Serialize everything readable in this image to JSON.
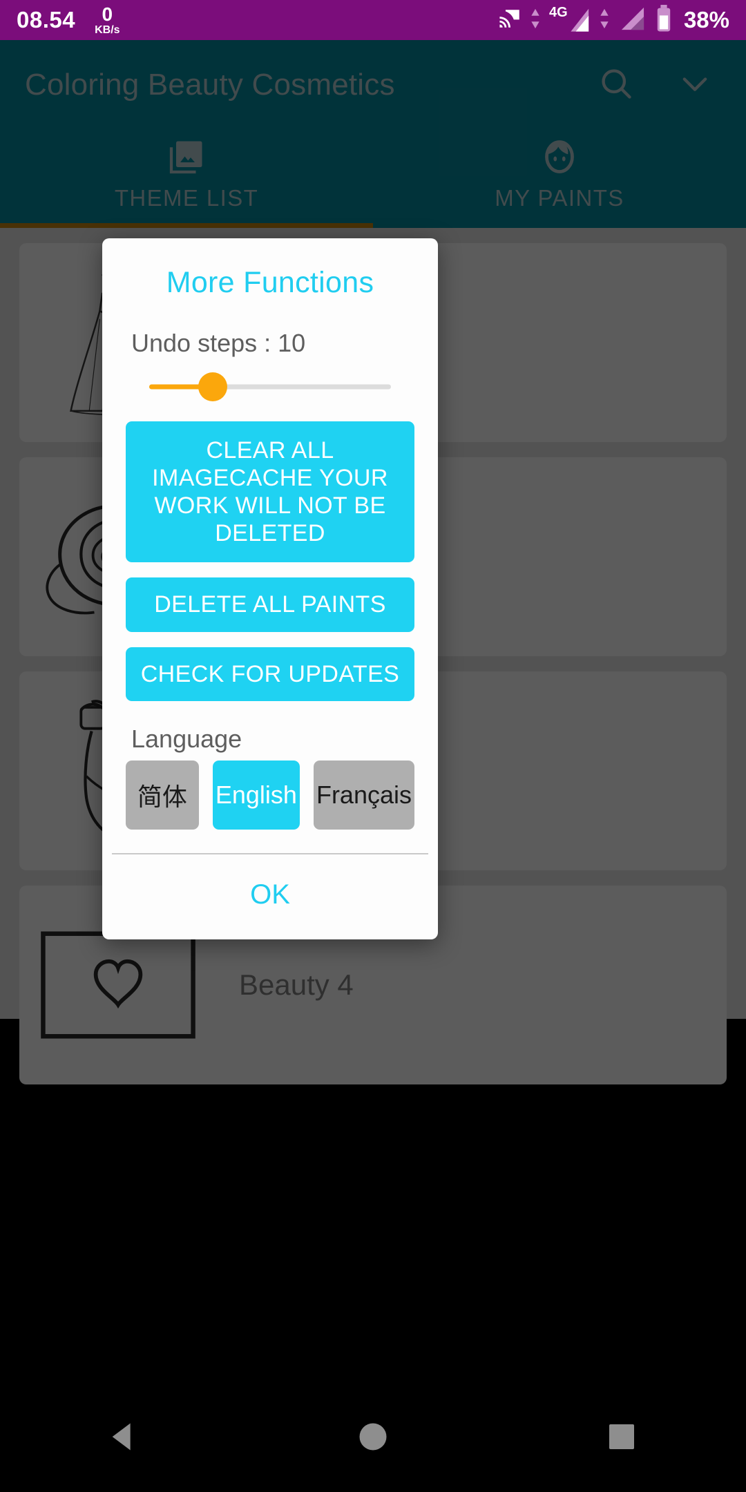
{
  "statusbar": {
    "time": "08.54",
    "speed_value": "0",
    "speed_unit": "KB/s",
    "network_type": "4G",
    "battery": "38%",
    "icons": [
      "cast-icon",
      "data-arrows-icon",
      "signal-bars-icon",
      "signal-bars-2-icon",
      "battery-icon"
    ],
    "background_color": "#7B0D7B"
  },
  "appbar": {
    "title": "Coloring Beauty Cosmetics",
    "search_icon": "search-icon",
    "expand_icon": "chevron-down-icon",
    "background_color": "#03616E",
    "tabs": [
      {
        "label": "THEME LIST",
        "icon": "photo-library-icon",
        "active": true
      },
      {
        "label": "MY PAINTS",
        "icon": "face-icon",
        "active": false
      }
    ],
    "indicator_color": "#8A5D0C"
  },
  "content": {
    "cards": [
      {
        "art": "dress-icon",
        "title": ""
      },
      {
        "art": "rose-icon",
        "title": ""
      },
      {
        "art": "highheel-icon",
        "title": ""
      },
      {
        "art": "envelope-heart-icon",
        "title": "Beauty 4"
      }
    ]
  },
  "dialog": {
    "title": "More Functions",
    "undo_label": "Undo steps : 10",
    "undo_value": 10,
    "slider_percent": 22,
    "slider_color": "#FBA70C",
    "accent_color": "#1FD2F2",
    "buttons": [
      {
        "label": "CLEAR ALL IMAGECACHE YOUR WORK WILL NOT BE DELETED",
        "name": "clear-image-cache-button"
      },
      {
        "label": "DELETE ALL PAINTS",
        "name": "delete-all-paints-button"
      },
      {
        "label": "CHECK FOR UPDATES",
        "name": "check-for-updates-button"
      }
    ],
    "language_label": "Language",
    "languages": [
      {
        "label": "简体",
        "selected": false
      },
      {
        "label": "English",
        "selected": true
      },
      {
        "label": "Français",
        "selected": false
      }
    ],
    "ok_label": "OK"
  },
  "navbar": {
    "back_icon": "back-triangle-icon",
    "home_icon": "home-circle-icon",
    "recents_icon": "recents-square-icon"
  }
}
